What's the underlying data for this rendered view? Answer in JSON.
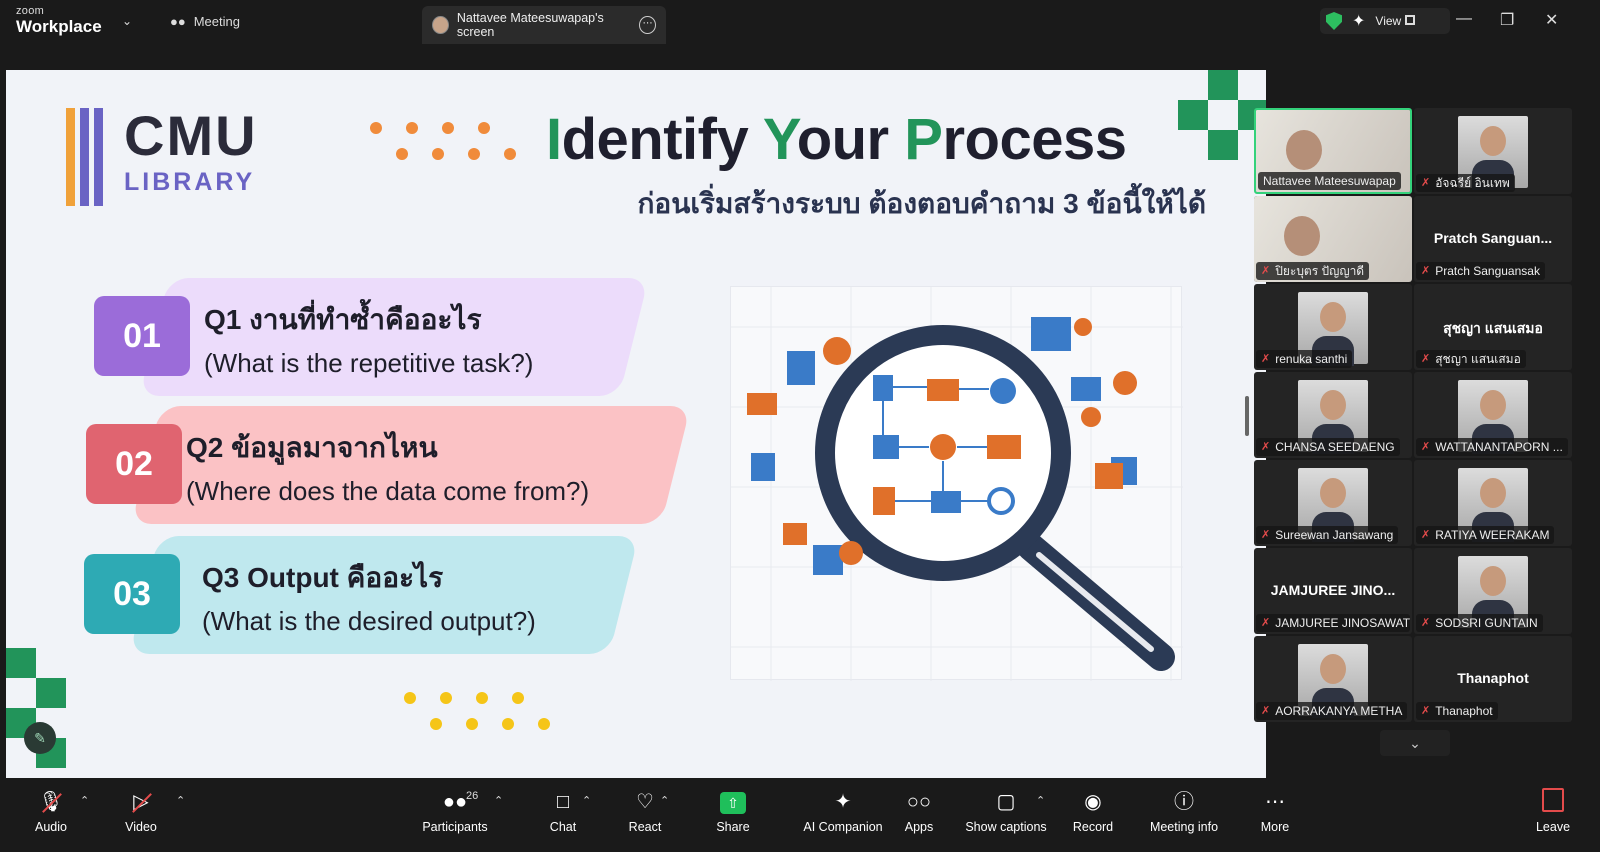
{
  "topbar": {
    "brand_small": "zoom",
    "brand_large": "Workplace",
    "meeting_tab": "Meeting",
    "screen_tab": "Nattavee Mateesuwapap's screen",
    "view_label": "View"
  },
  "slide": {
    "logo_cmu": "CMU",
    "logo_library": "LIBRARY",
    "title_parts": [
      "I",
      "dentify ",
      "Y",
      "our ",
      "P",
      "rocess"
    ],
    "subtitle": "ก่อนเริ่มสร้างระบบ ต้องตอบคำถาม 3 ข้อนี้ให้ได้",
    "questions": [
      {
        "num": "01",
        "thai": "Q1 งานที่ทำซ้ำคืออะไร",
        "eng": "(What is the repetitive task?)"
      },
      {
        "num": "02",
        "thai": "Q2 ข้อมูลมาจากไหน",
        "eng": "(Where does the data come from?)"
      },
      {
        "num": "03",
        "thai": "Q3 Output คืออะไร",
        "eng": "(What is the desired output?)"
      }
    ]
  },
  "participants": [
    {
      "label": "Nattavee Mateesuwapap",
      "big": "",
      "muted": false
    },
    {
      "label": "อัจฉรีย์ อินเทพ",
      "big": "",
      "muted": true
    },
    {
      "label": "ปิยะบุตร ปัญญาดี",
      "big": "",
      "muted": true
    },
    {
      "label": "Pratch Sanguansak",
      "big": "Pratch  Sanguan...",
      "muted": true
    },
    {
      "label": "renuka santhi",
      "big": "",
      "muted": true
    },
    {
      "label": "สุชญา แสนเสมอ",
      "big": "สุชญา แสนเสมอ",
      "muted": true
    },
    {
      "label": "CHANSA SEEDAENG",
      "big": "",
      "muted": true
    },
    {
      "label": "WATTANANTAPORN ...",
      "big": "",
      "muted": true
    },
    {
      "label": "Sureewan Jansawang",
      "big": "",
      "muted": true
    },
    {
      "label": "RATIYA WEERAKAM",
      "big": "",
      "muted": true
    },
    {
      "label": "JAMJUREE JINOSAWAT",
      "big": "JAMJUREE JINO...",
      "muted": true
    },
    {
      "label": "SODSRI GUNTAIN",
      "big": "",
      "muted": true
    },
    {
      "label": "AORRAKANYA METHA",
      "big": "",
      "muted": true
    },
    {
      "label": "Thanaphot",
      "big": "Thanaphot",
      "muted": true
    }
  ],
  "toolbar": {
    "audio": "Audio",
    "video": "Video",
    "participants": "Participants",
    "participants_count": "26",
    "chat": "Chat",
    "react": "React",
    "share": "Share",
    "ai": "AI Companion",
    "apps": "Apps",
    "captions": "Show captions",
    "record": "Record",
    "info": "Meeting info",
    "more": "More",
    "leave": "Leave"
  },
  "colors": {
    "accent_green": "#22945a",
    "q1": "#9b6cd9",
    "q2": "#e06470",
    "q3": "#2eaab4",
    "mute_red": "#e34b4b"
  }
}
